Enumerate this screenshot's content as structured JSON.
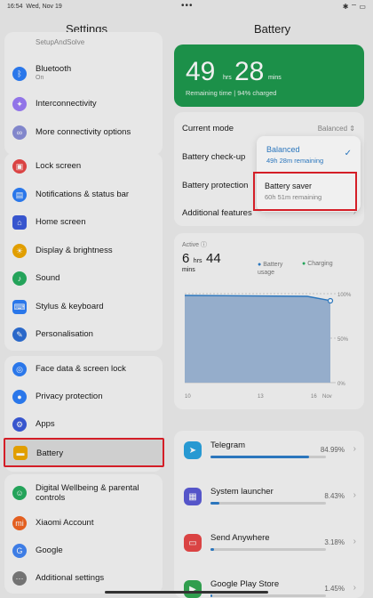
{
  "status": {
    "time": "16:54",
    "date": "Wed, Nov 19",
    "dots": "•••",
    "battery_icons": "✱ ⌔ ▭"
  },
  "settings": {
    "title": "Settings",
    "top_item": "SetupAndSolve",
    "group1": [
      {
        "label": "Bluetooth",
        "sub": "On",
        "icon": "bluetooth-icon",
        "color": "#2d7ff9"
      },
      {
        "label": "Interconnectivity",
        "icon": "interconnectivity-icon",
        "color": "#9b7cf7"
      },
      {
        "label": "More connectivity options",
        "icon": "connectivity-icon",
        "color": "#8a8fd8"
      }
    ],
    "group2": [
      {
        "label": "Lock screen",
        "icon": "lock-icon",
        "color": "#e84848"
      },
      {
        "label": "Notifications & status bar",
        "icon": "notifications-icon",
        "color": "#2d7ff9"
      },
      {
        "label": "Home screen",
        "icon": "home-icon",
        "color": "#3b5bdb"
      },
      {
        "label": "Display & brightness",
        "icon": "display-icon",
        "color": "#f0a800"
      },
      {
        "label": "Sound",
        "icon": "sound-icon",
        "color": "#27ae60"
      },
      {
        "label": "Stylus & keyboard",
        "icon": "stylus-icon",
        "color": "#2d7ff9"
      },
      {
        "label": "Personalisation",
        "icon": "personalisation-icon",
        "color": "#2d6fd6"
      }
    ],
    "group3": [
      {
        "label": "Face data & screen lock",
        "icon": "face-icon",
        "color": "#2d7ff9"
      },
      {
        "label": "Privacy protection",
        "icon": "privacy-icon",
        "color": "#2d7ff9"
      },
      {
        "label": "Apps",
        "icon": "apps-icon",
        "color": "#3b5bdb"
      },
      {
        "label": "Battery",
        "icon": "battery-icon",
        "color": "#f0a800"
      }
    ],
    "group4": [
      {
        "label": "Digital Wellbeing & parental controls",
        "icon": "wellbeing-icon",
        "color": "#27ae60"
      },
      {
        "label": "Xiaomi Account",
        "icon": "xiaomi-icon",
        "color": "#f26522"
      },
      {
        "label": "Google",
        "icon": "google-icon",
        "color": "#4285f4"
      },
      {
        "label": "Additional settings",
        "icon": "additional-settings-icon",
        "color": "#7b7b7b"
      }
    ]
  },
  "battery": {
    "title": "Battery",
    "hours": "49",
    "hrs_label": "hrs",
    "mins": "28",
    "mins_label": "mins",
    "remaining": "Remaining time | 94% charged",
    "current_mode_label": "Current mode",
    "current_mode_value": "Balanced",
    "checkup_label": "Battery check-up",
    "protection_label": "Battery protection",
    "additional_label": "Additional features",
    "popup": {
      "balanced": {
        "title": "Balanced",
        "sub": "49h 28m remaining"
      },
      "saver": {
        "title": "Battery saver",
        "sub": "60h 51m remaining"
      }
    },
    "active_label": "Active",
    "active_hours": "6",
    "active_hrs": "hrs",
    "active_mins": "44",
    "active_mins_label": "mins",
    "legend_usage": "Battery usage",
    "legend_charging": "Charging",
    "y_labels": [
      "100%",
      "50%",
      "0%"
    ],
    "x_labels": [
      "10",
      "13",
      "16",
      "Nov"
    ],
    "apps": [
      {
        "name": "Telegram",
        "pct": "84.99%",
        "fill": 0.85,
        "icon": "telegram-icon",
        "color": "#2aa3e0"
      },
      {
        "name": "System launcher",
        "pct": "8.43%",
        "fill": 0.08,
        "icon": "system-launcher-icon",
        "color": "#5b5bd6"
      },
      {
        "name": "Send Anywhere",
        "pct": "3.18%",
        "fill": 0.03,
        "icon": "send-anywhere-icon",
        "color": "#e84848"
      },
      {
        "name": "Google Play Store",
        "pct": "1.45%",
        "fill": 0.015,
        "icon": "play-store-icon",
        "color": "#34a853"
      }
    ]
  }
}
